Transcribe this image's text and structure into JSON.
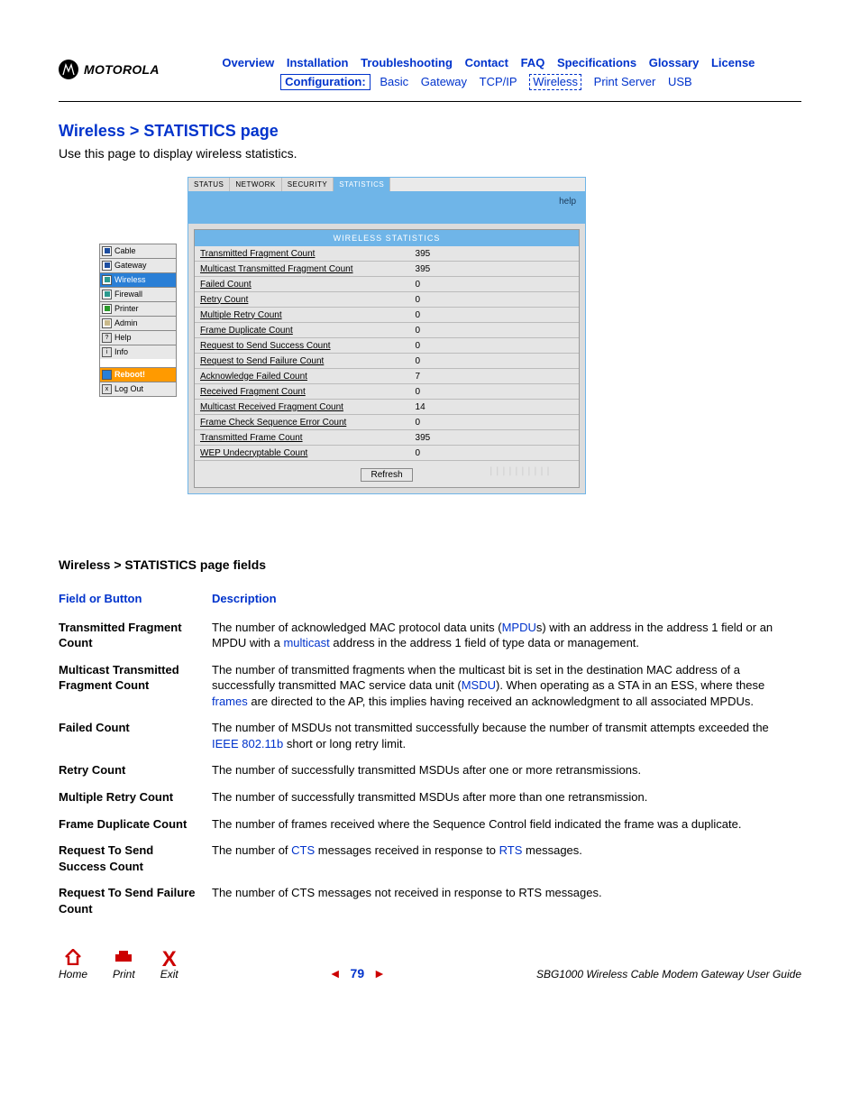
{
  "brand": "MOTOROLA",
  "nav": {
    "top": [
      "Overview",
      "Installation",
      "Troubleshooting",
      "Contact",
      "FAQ",
      "Specifications",
      "Glossary",
      "License"
    ],
    "config_label": "Configuration:",
    "config_items": [
      "Basic",
      "Gateway",
      "TCP/IP",
      "Wireless",
      "Print Server",
      "USB"
    ],
    "config_active": "Wireless"
  },
  "page_title": "Wireless > STATISTICS page",
  "intro": "Use this page to display wireless statistics.",
  "side_menu": {
    "items": [
      {
        "label": "Cable",
        "dot": "blue"
      },
      {
        "label": "Gateway",
        "dot": "blue"
      },
      {
        "label": "Wireless",
        "dot": "teal",
        "active": true
      },
      {
        "label": "Firewall",
        "dot": "teal"
      },
      {
        "label": "Printer",
        "dot": "green"
      },
      {
        "label": "Admin",
        "dot": "tan"
      },
      {
        "label": "Help",
        "char": "?"
      },
      {
        "label": "Info",
        "char": "i"
      }
    ],
    "reboot": "Reboot!",
    "logout": "Log Out"
  },
  "tabs": [
    "STATUS",
    "NETWORK",
    "SECURITY",
    "STATISTICS"
  ],
  "tabs_active": 3,
  "help_label": "help",
  "stats_header": "WIRELESS STATISTICS",
  "stats": [
    {
      "label": "Transmitted Fragment Count",
      "value": "395"
    },
    {
      "label": "Multicast Transmitted Fragment Count",
      "value": "395"
    },
    {
      "label": "Failed Count",
      "value": "0"
    },
    {
      "label": "Retry Count",
      "value": "0"
    },
    {
      "label": "Multiple Retry Count",
      "value": "0"
    },
    {
      "label": "Frame Duplicate Count",
      "value": "0"
    },
    {
      "label": "Request to Send Success Count",
      "value": "0"
    },
    {
      "label": "Request to Send Failure Count",
      "value": "0"
    },
    {
      "label": "Acknowledge Failed Count",
      "value": "7"
    },
    {
      "label": "Received Fragment Count",
      "value": "0"
    },
    {
      "label": "Multicast Received Fragment Count",
      "value": "14"
    },
    {
      "label": "Frame Check Sequence Error Count",
      "value": "0"
    },
    {
      "label": "Transmitted Frame Count",
      "value": "395"
    },
    {
      "label": "WEP Undecryptable Count",
      "value": "0"
    }
  ],
  "refresh_label": "Refresh",
  "section_subtitle": "Wireless > STATISTICS page fields",
  "desc_header": {
    "field": "Field or Button",
    "desc": "Description"
  },
  "descriptions": [
    {
      "field": "Transmitted Fragment Count",
      "parts": [
        "The number of acknowledged MAC protocol data units (",
        {
          "link": "MPDU"
        },
        "s) with an address in the address 1 field or an MPDU with a ",
        {
          "link": "multicast"
        },
        " address in the address 1 field of type data or management."
      ]
    },
    {
      "field": "Multicast Transmitted Fragment Count",
      "parts": [
        "The number of transmitted fragments when the multicast bit is set in the destination MAC address of a successfully transmitted MAC service data unit (",
        {
          "link": "MSDU"
        },
        "). When operating as a STA in an ESS, where these ",
        {
          "link": "frames"
        },
        " are directed to the AP, this implies having received an acknowledgment to all associated MPDUs."
      ]
    },
    {
      "field": "Failed Count",
      "parts": [
        "The number of MSDUs not transmitted successfully because the number of transmit attempts exceeded the ",
        {
          "link": "IEEE 802.11b"
        },
        " short or long retry limit."
      ]
    },
    {
      "field": "Retry Count",
      "parts": [
        "The number of successfully transmitted MSDUs after one or more retransmissions."
      ]
    },
    {
      "field": "Multiple Retry Count",
      "parts": [
        "The number of successfully transmitted MSDUs after more than one retransmission."
      ]
    },
    {
      "field": "Frame Duplicate Count",
      "parts": [
        "The number of frames received where the Sequence Control field indicated the frame was a duplicate."
      ]
    },
    {
      "field": "Request To Send Success Count",
      "parts": [
        "The number of ",
        {
          "link": "CTS"
        },
        " messages received in response to ",
        {
          "link": "RTS"
        },
        " messages."
      ]
    },
    {
      "field": "Request To Send Failure Count",
      "parts": [
        "The number of CTS messages not received in response to RTS messages."
      ]
    }
  ],
  "footer": {
    "home": "Home",
    "print": "Print",
    "exit": "Exit",
    "page": "79",
    "guide": "SBG1000 Wireless Cable Modem Gateway User Guide"
  }
}
